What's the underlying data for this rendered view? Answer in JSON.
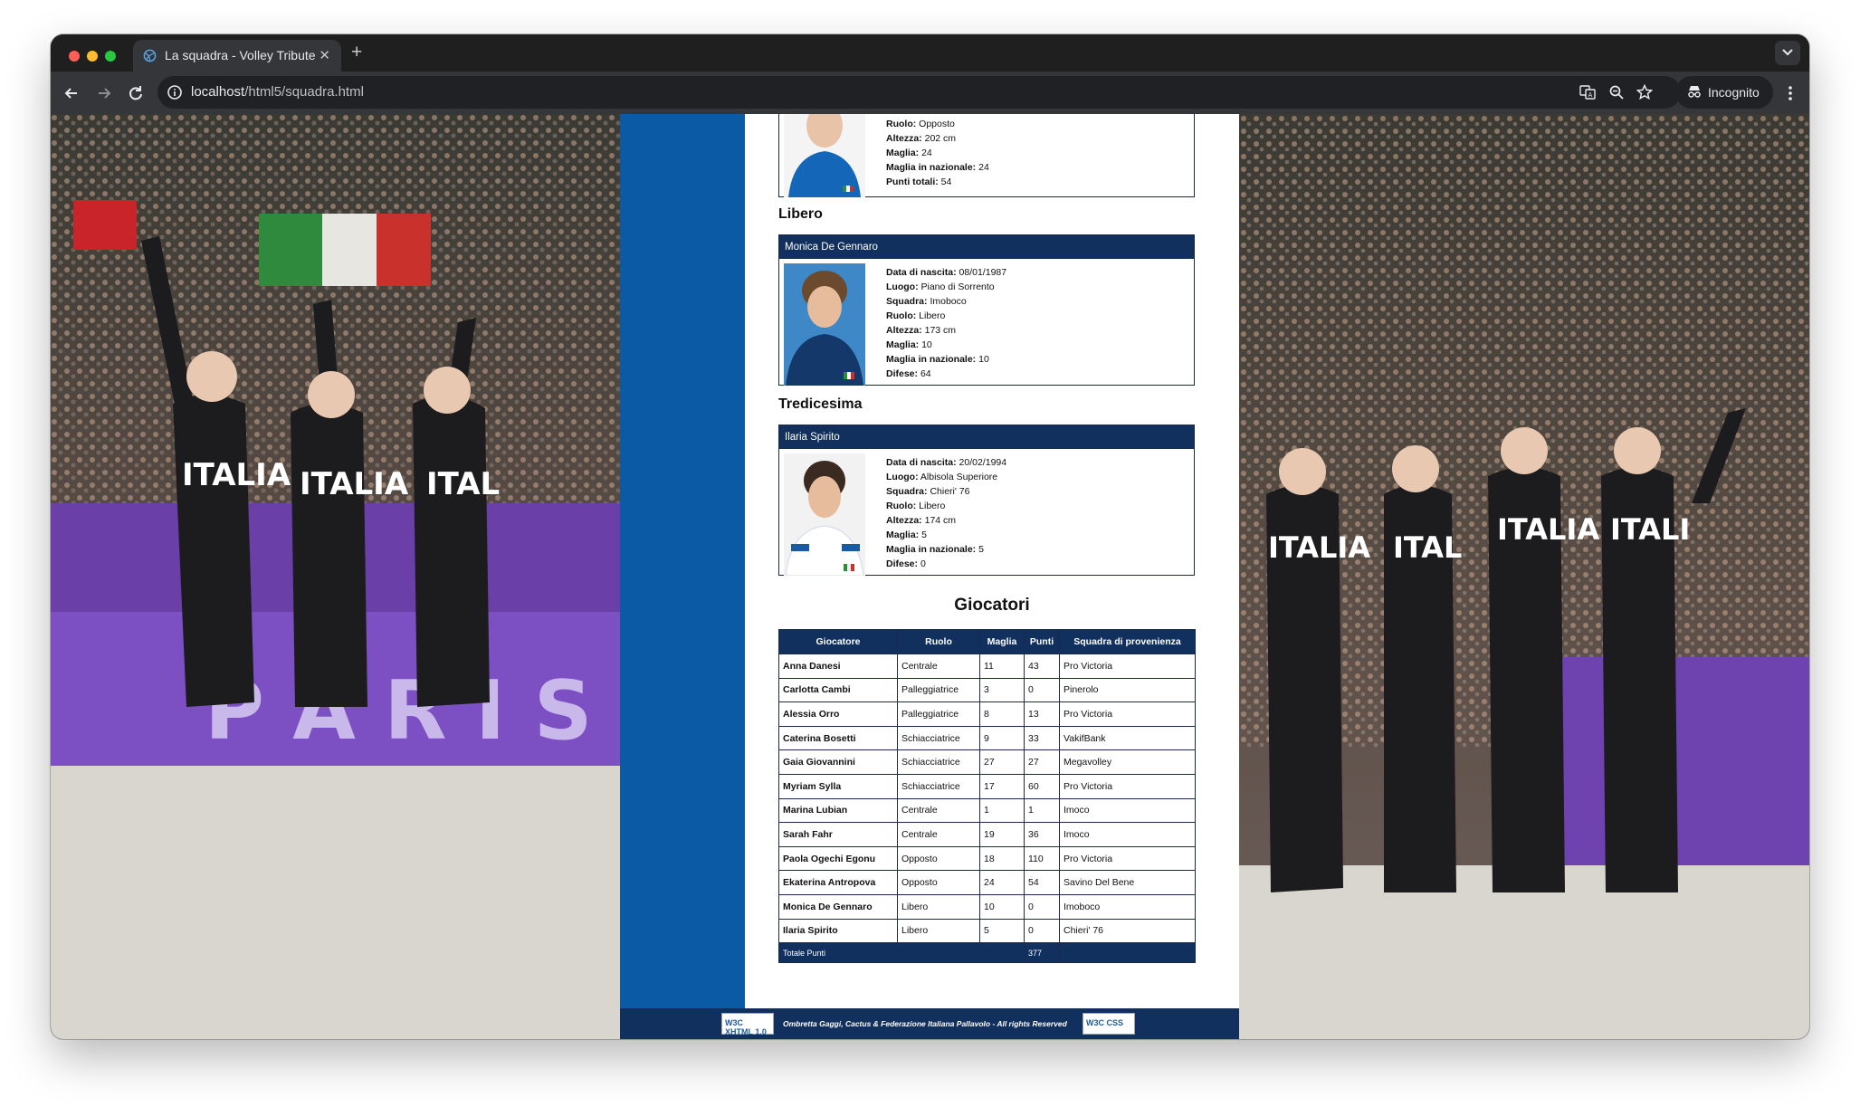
{
  "browser": {
    "tab_title": "La squadra - Volley Tribute",
    "url_host": "localhost",
    "url_path": "/html5/squadra.html",
    "incognito_label": "Incognito"
  },
  "cards": {
    "top": {
      "rows": [
        {
          "label": "Ruolo:",
          "value": "Opposto"
        },
        {
          "label": "Altezza:",
          "value": "202 cm"
        },
        {
          "label": "Maglia:",
          "value": "24"
        },
        {
          "label": "Maglia in nazionale:",
          "value": "24"
        },
        {
          "label": "Punti totali:",
          "value": "54"
        }
      ]
    },
    "libero_heading": "Libero",
    "libero": {
      "name": "Monica De Gennaro",
      "rows": [
        {
          "label": "Data di nascita:",
          "value": "08/01/1987"
        },
        {
          "label": "Luogo:",
          "value": "Piano di Sorrento"
        },
        {
          "label": "Squadra:",
          "value": "Imoboco"
        },
        {
          "label": "Ruolo:",
          "value": "Libero"
        },
        {
          "label": "Altezza:",
          "value": "173 cm"
        },
        {
          "label": "Maglia:",
          "value": "10"
        },
        {
          "label": "Maglia in nazionale:",
          "value": "10"
        },
        {
          "label": "Difese:",
          "value": "64"
        }
      ]
    },
    "tredicesima_heading": "Tredicesima",
    "tredicesima": {
      "name": "Ilaria Spirito",
      "rows": [
        {
          "label": "Data di nascita:",
          "value": "20/02/1994"
        },
        {
          "label": "Luogo:",
          "value": "Albisola Superiore"
        },
        {
          "label": "Squadra:",
          "value": "Chieri' 76"
        },
        {
          "label": "Ruolo:",
          "value": "Libero"
        },
        {
          "label": "Altezza:",
          "value": "174 cm"
        },
        {
          "label": "Maglia:",
          "value": "5"
        },
        {
          "label": "Maglia in nazionale:",
          "value": "5"
        },
        {
          "label": "Difese:",
          "value": "0"
        }
      ]
    }
  },
  "players_table": {
    "title": "Giocatori",
    "headers": [
      "Giocatore",
      "Ruolo",
      "Maglia",
      "Punti",
      "Squadra di provenienza"
    ],
    "rows": [
      [
        "Anna Danesi",
        "Centrale",
        "11",
        "43",
        "Pro Victoria"
      ],
      [
        "Carlotta Cambi",
        "Palleggiatrice",
        "3",
        "0",
        "Pinerolo"
      ],
      [
        "Alessia Orro",
        "Palleggiatrice",
        "8",
        "13",
        "Pro Victoria"
      ],
      [
        "Caterina Bosetti",
        "Schiacciatrice",
        "9",
        "33",
        "VakifBank"
      ],
      [
        "Gaia Giovannini",
        "Schiacciatrice",
        "27",
        "27",
        "Megavolley"
      ],
      [
        "Myriam Sylla",
        "Schiacciatrice",
        "17",
        "60",
        "Pro Victoria"
      ],
      [
        "Marina Lubian",
        "Centrale",
        "1",
        "1",
        "Imoco"
      ],
      [
        "Sarah Fahr",
        "Centrale",
        "19",
        "36",
        "Imoco"
      ],
      [
        "Paola Ogechi Egonu",
        "Opposto",
        "18",
        "110",
        "Pro Victoria"
      ],
      [
        "Ekaterina Antropova",
        "Opposto",
        "24",
        "54",
        "Savino Del Bene"
      ],
      [
        "Monica De Gennaro",
        "Libero",
        "10",
        "0",
        "Imoboco"
      ],
      [
        "Ilaria Spirito",
        "Libero",
        "5",
        "0",
        "Chieri' 76"
      ]
    ],
    "total_label": "Totale Punti",
    "total_value": "377"
  },
  "footer": {
    "text": "Ombretta Gaggi, Cactus & Federazione Italiana Pallavolo - All rights Reserved",
    "badge_xhtml": "W3C XHTML 1.0",
    "badge_css": "W3C CSS"
  }
}
